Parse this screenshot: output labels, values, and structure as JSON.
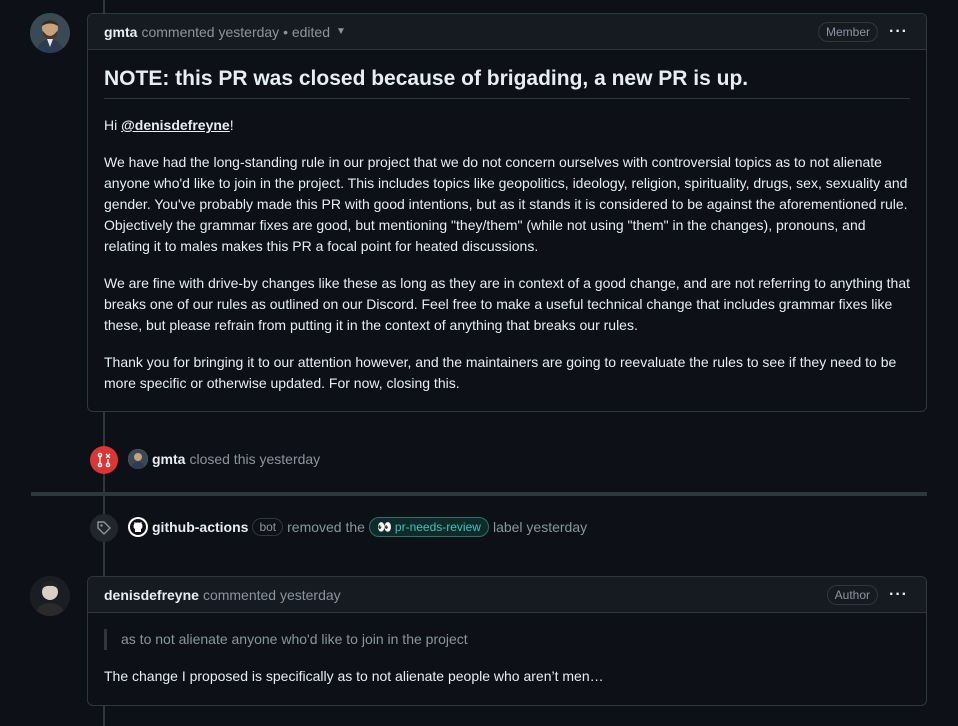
{
  "comment1": {
    "author": "gmta",
    "meta": "commented yesterday • edited",
    "role": "Member",
    "heading": "NOTE: this PR was closed because of brigading, a new PR is up.",
    "greeting_prefix": "Hi ",
    "mention": "@denisdefreyne",
    "greeting_suffix": "!",
    "p1": "We have had the long-standing rule in our project that we do not concern ourselves with controversial topics as to not alienate anyone who'd like to join in the project. This includes topics like geopolitics, ideology, religion, spirituality, drugs, sex, sexuality and gender. You've probably made this PR with good intentions, but as it stands it is considered to be against the aforementioned rule. Objectively the grammar fixes are good, but mentioning \"they/them\" (while not using \"them\" in the changes), pronouns, and relating it to males makes this PR a focal point for heated discussions.",
    "p2": "We are fine with drive-by changes like these as long as they are in context of a good change, and are not referring to anything that breaks one of our rules as outlined on our Discord. Feel free to make a useful technical change that includes grammar fixes like these, but please refrain from putting it in the context of anything that breaks our rules.",
    "p3": "Thank you for bringing it to our attention however, and the maintainers are going to reevaluate the rules to see if they need to be more specific or otherwise updated. For now, closing this."
  },
  "event_closed": {
    "actor": "gmta",
    "text": "closed this yesterday"
  },
  "event_label": {
    "actor": "github-actions",
    "bot": "bot",
    "pre": "removed the",
    "label_emoji": "👀",
    "label": "pr-needs-review",
    "post": "label yesterday"
  },
  "comment2": {
    "author": "denisdefreyne",
    "meta": "commented yesterday",
    "role": "Author",
    "quote": "as to not alienate anyone who'd like to join in the project",
    "body": "The change I proposed is specifically as to not alienate people who aren’t men…"
  },
  "colors": {
    "background": "#0d1117",
    "closed": "#da3633",
    "label": "#39c5bb"
  }
}
